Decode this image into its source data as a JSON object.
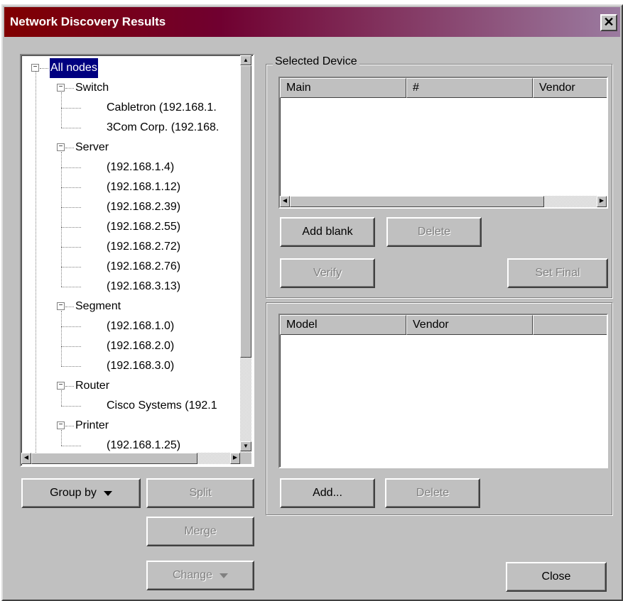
{
  "window": {
    "title": "Network Discovery Results",
    "close_glyph": "✕"
  },
  "tree": {
    "nodes": [
      {
        "label": "All nodes",
        "level": 0,
        "expander": "−"
      },
      {
        "label": "Switch",
        "level": 1,
        "expander": "−"
      },
      {
        "label": "Cabletron (192.168.1.",
        "level": 2
      },
      {
        "label": "3Com Corp. (192.168.",
        "level": 2
      },
      {
        "label": "Server",
        "level": 1,
        "expander": "−"
      },
      {
        "label": "(192.168.1.4)",
        "level": 2
      },
      {
        "label": "(192.168.1.12)",
        "level": 2
      },
      {
        "label": "(192.168.2.39)",
        "level": 2
      },
      {
        "label": "(192.168.2.55)",
        "level": 2
      },
      {
        "label": "(192.168.2.72)",
        "level": 2
      },
      {
        "label": "(192.168.2.76)",
        "level": 2
      },
      {
        "label": "(192.168.3.13)",
        "level": 2
      },
      {
        "label": "Segment",
        "level": 1,
        "expander": "−"
      },
      {
        "label": "(192.168.1.0)",
        "level": 2
      },
      {
        "label": "(192.168.2.0)",
        "level": 2
      },
      {
        "label": "(192.168.3.0)",
        "level": 2
      },
      {
        "label": "Router",
        "level": 1,
        "expander": "−"
      },
      {
        "label": "Cisco Systems (192.1",
        "level": 2
      },
      {
        "label": "Printer",
        "level": 1,
        "expander": "−"
      },
      {
        "label": "(192.168.1.25)",
        "level": 2
      }
    ]
  },
  "left_buttons": {
    "group_by": "Group by",
    "split": "Split",
    "merge": "Merge",
    "change": "Change"
  },
  "selected_device": {
    "label": "Selected Device",
    "columns": [
      "Main",
      "#",
      "Vendor"
    ],
    "add_blank": "Add blank",
    "delete": "Delete",
    "verify": "Verify",
    "set_final": "Set Final"
  },
  "models": {
    "columns": [
      "Model",
      "Vendor",
      ""
    ],
    "add": "Add...",
    "delete": "Delete"
  },
  "footer": {
    "close": "Close"
  },
  "icons": {
    "expander": "minus-box-icon",
    "scroll_up": "arrow-up-icon",
    "scroll_down": "arrow-down-icon",
    "scroll_left": "arrow-left-icon",
    "scroll_right": "arrow-right-icon",
    "dropdown": "chevron-down-icon"
  },
  "colors": {
    "title_start": "#800000",
    "title_end": "#9b7ba0",
    "selection": "#000080",
    "face": "#c0c0c0"
  }
}
